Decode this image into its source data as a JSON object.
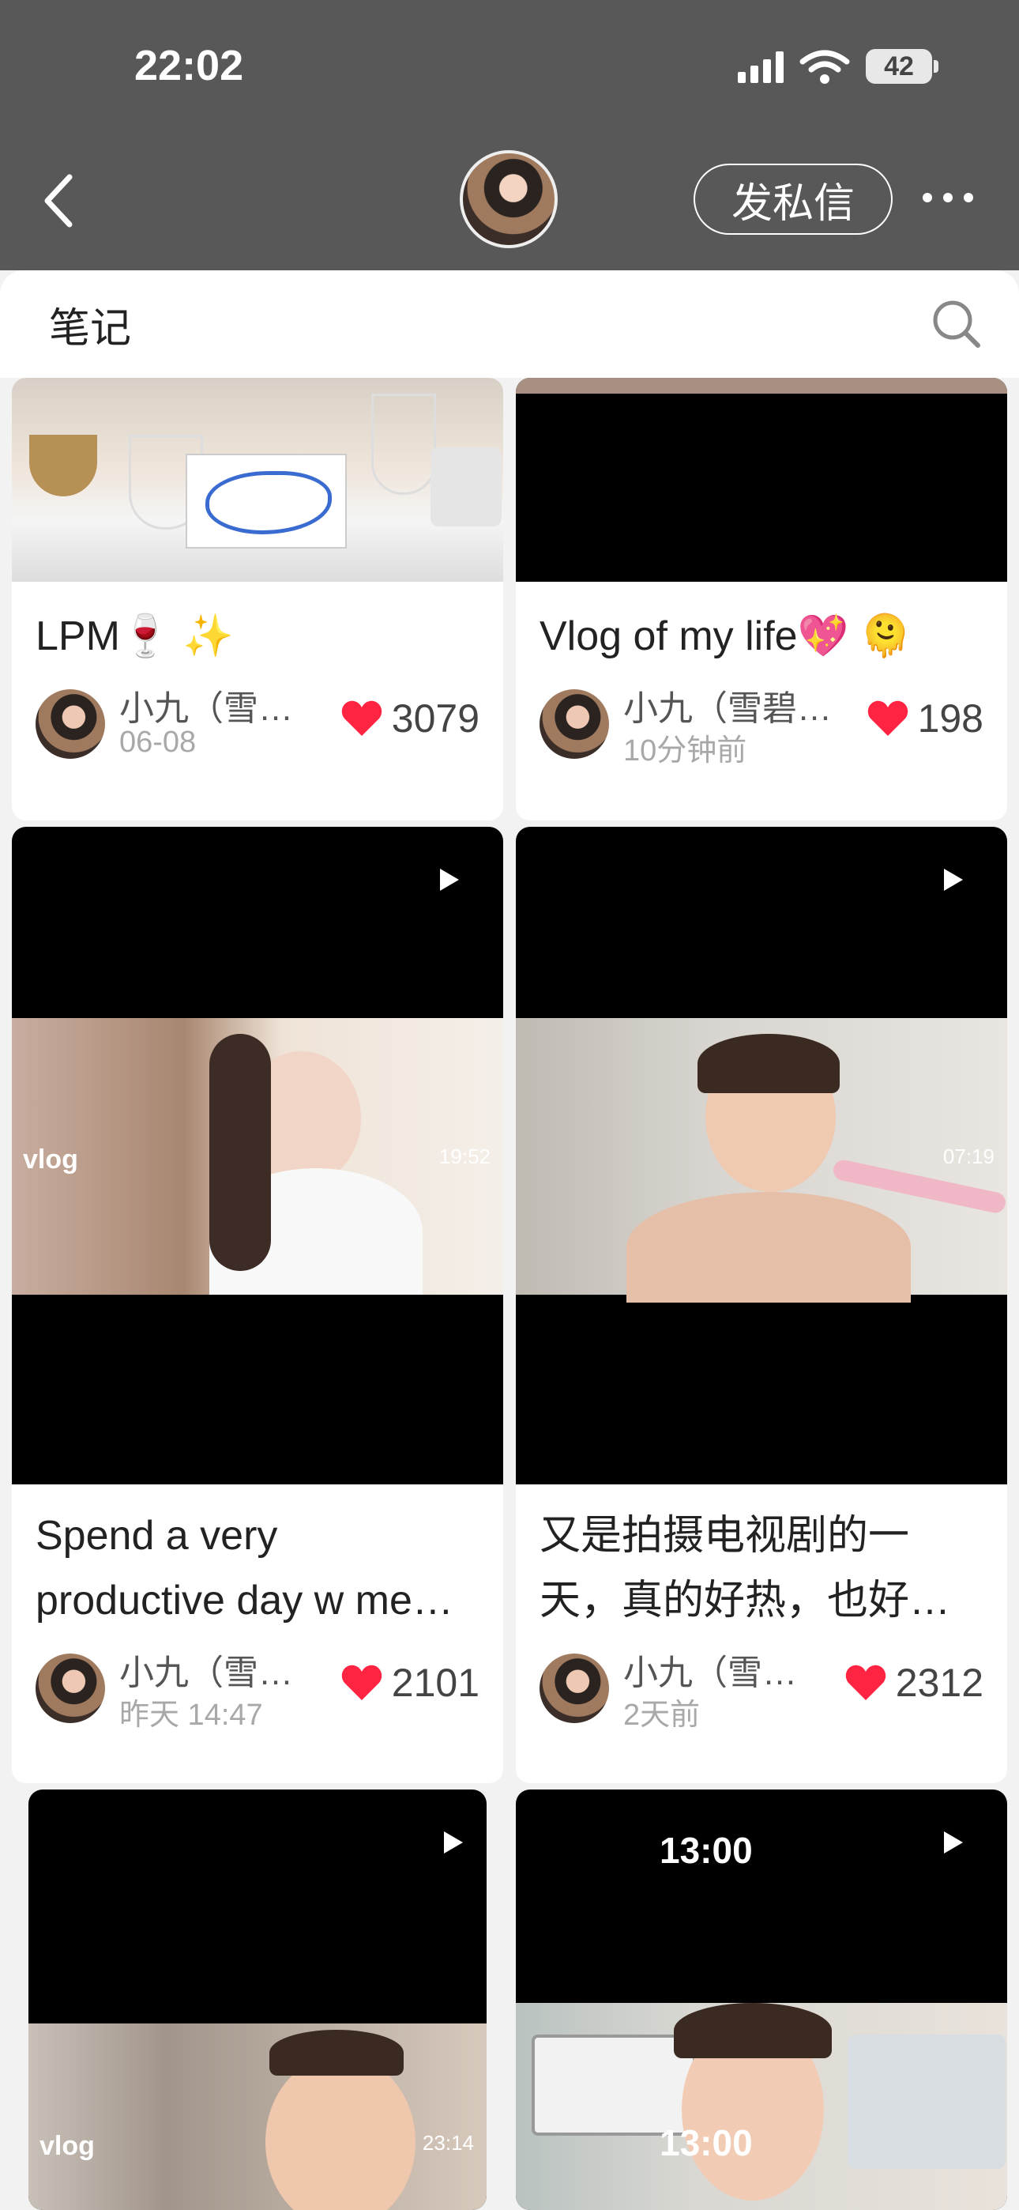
{
  "status": {
    "time": "22:02",
    "battery": "42"
  },
  "top_actions": {
    "message_button": "发私信"
  },
  "sheet": {
    "title": "笔记"
  },
  "cards": [
    {
      "title": "LPM🍷 ✨",
      "author": "小九（雪…",
      "time": "06-08",
      "likes": "3079"
    },
    {
      "title": "Vlog of my life💖 🫠",
      "author": "小九（雪碧…",
      "time": "10分钟前",
      "likes": "198"
    },
    {
      "title": "Spend a very\nproductive day w me…",
      "author": "小九（雪…",
      "time": "昨天 14:47",
      "likes": "2101",
      "vlog": "vlog",
      "duration": "19:52"
    },
    {
      "title": "又是拍摄电视剧的一\n天，真的好热，也好…",
      "author": "小九（雪…",
      "time": "2天前",
      "likes": "2312",
      "duration": "07:19"
    },
    {
      "vlog": "vlog",
      "duration": "23:14"
    },
    {
      "overlay1": "13:00",
      "overlay2": "13:00"
    }
  ]
}
